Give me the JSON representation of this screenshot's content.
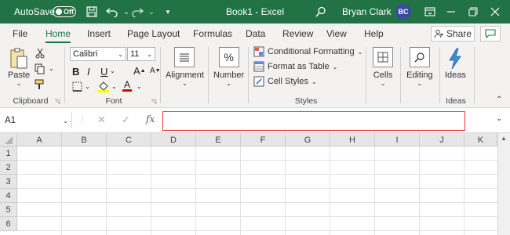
{
  "titlebar": {
    "autosave_label": "AutoSave",
    "autosave_state": "Off",
    "document_title": "Book1  -  Excel",
    "user_name": "Bryan Clark",
    "user_initials": "BC",
    "background_color": "#217346"
  },
  "tabs": [
    "File",
    "Home",
    "Insert",
    "Page Layout",
    "Formulas",
    "Data",
    "Review",
    "View",
    "Help"
  ],
  "active_tab": "Home",
  "share_label": "Share",
  "ribbon": {
    "clipboard": {
      "paste_label": "Paste",
      "group_label": "Clipboard"
    },
    "font": {
      "font_name": "Calibri",
      "font_size": "11",
      "bold": "B",
      "italic": "I",
      "underline": "U",
      "font_color_glyph": "A",
      "group_label": "Font"
    },
    "alignment": {
      "label": "Alignment"
    },
    "number": {
      "label": "Number",
      "icon_glyph": "%"
    },
    "styles": {
      "conditional_formatting": "Conditional Formatting",
      "format_as_table": "Format as Table",
      "cell_styles": "Cell Styles",
      "group_label": "Styles"
    },
    "cells": {
      "label": "Cells"
    },
    "editing": {
      "label": "Editing"
    },
    "ideas": {
      "label": "Ideas",
      "group_label": "Ideas"
    }
  },
  "formula_bar": {
    "name_box": "A1",
    "fx": "fx",
    "value": ""
  },
  "columns": [
    "A",
    "B",
    "C",
    "D",
    "E",
    "F",
    "G",
    "H",
    "I",
    "J",
    "K"
  ],
  "rows": [
    "1",
    "2",
    "3",
    "4",
    "5",
    "6"
  ],
  "colors": {
    "accent": "#217346",
    "highlight_border": "#e53935"
  }
}
